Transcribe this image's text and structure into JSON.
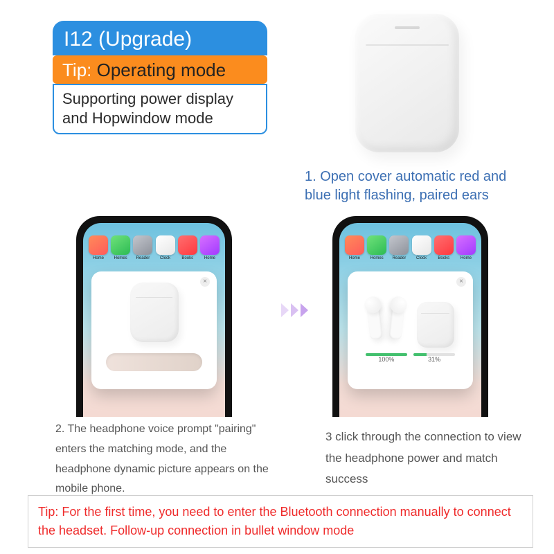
{
  "header": {
    "title": "I12 (Upgrade)",
    "tip_prefix": "Tip:",
    "tip_text": "Operating mode",
    "subtitle": "Supporting power display and Hopwindow mode"
  },
  "steps": {
    "s1": "1. Open cover automatic red and blue light flashing, paired ears",
    "s2": "2. The headphone voice prompt \"pairing\" enters the matching mode,\nand the headphone dynamic picture appears on the mobile phone.",
    "s3": "3 click through the connection to view the headphone power and match success"
  },
  "phone": {
    "app_labels": [
      "Home",
      "Homes",
      "Reader",
      "Clock",
      "Books",
      "Home"
    ],
    "popup_close": "×",
    "left_pct": "100%",
    "right_pct": "31%",
    "left_fill": "100%",
    "right_fill": "31%"
  },
  "bottom_tip": "Tip: For the first time, you need to enter the Bluetooth connection manually to connect the headset. Follow-up connection in bullet window mode"
}
